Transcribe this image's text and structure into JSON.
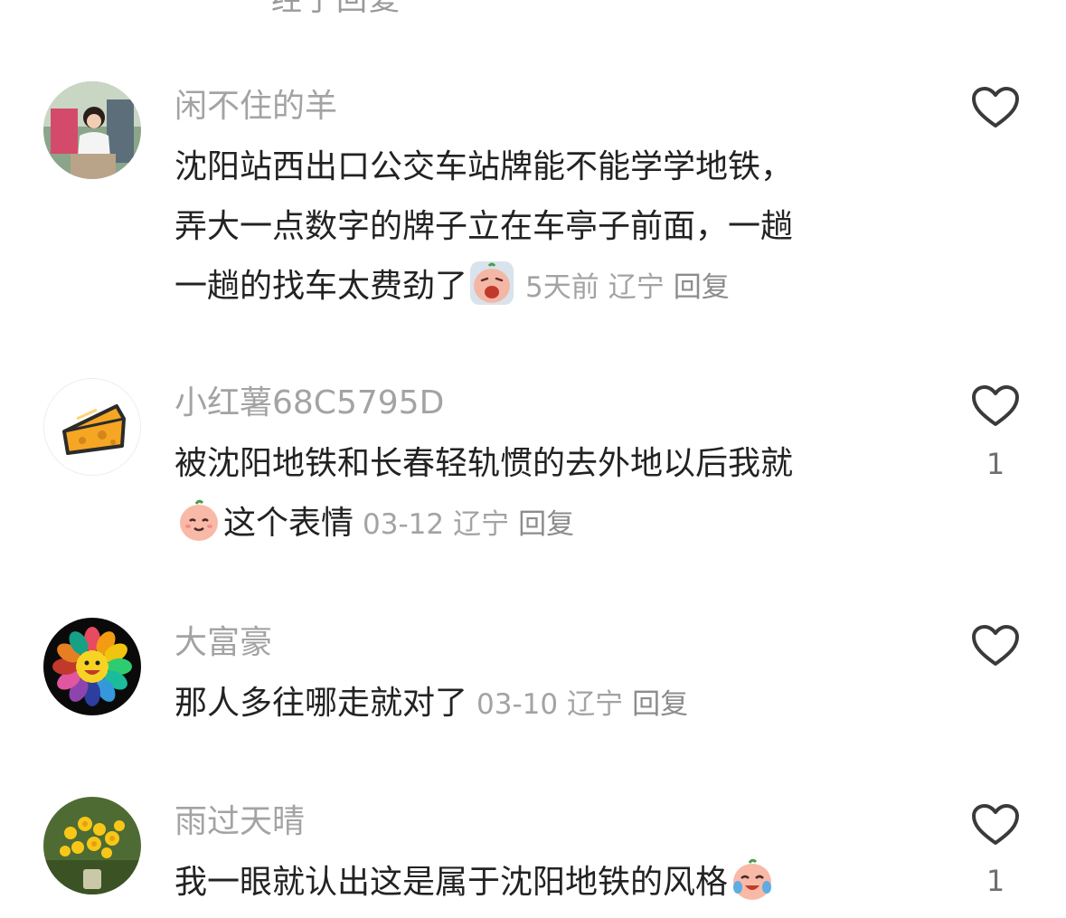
{
  "partial_top_text": "经了回复",
  "comments": [
    {
      "username": "闲不住的羊",
      "lines": [
        "沈阳站西出口公交车站牌能不能学学地铁，",
        "弄大一点数字的牌子立在车亭子前面，一趟",
        "一趟的找车太费劲了"
      ],
      "emoji": "crying-face-emoji",
      "time": "5天前",
      "location": "辽宁",
      "reply": "回复",
      "likes": ""
    },
    {
      "username": "小红薯68C5795D",
      "lines": [
        "被沈阳地铁和长春轻轨惯的去外地以后我就",
        "这个表情"
      ],
      "emoji": "smiling-face-emoji",
      "time": "03-12",
      "location": "辽宁",
      "reply": "回复",
      "likes": "1"
    },
    {
      "username": "大富豪",
      "lines": [
        "那人多往哪走就对了"
      ],
      "time": "03-10",
      "location": "辽宁",
      "reply": "回复",
      "likes": ""
    },
    {
      "username": "雨过天晴",
      "lines": [
        "我一眼就认出这是属于沈阳地铁的风格"
      ],
      "emoji": "laughing-tears-emoji",
      "likes": "1"
    }
  ],
  "colors": {
    "username": "#a3a3a3",
    "text": "#222222",
    "meta": "#a3a3a3",
    "like_outline": "#3a3a3a"
  }
}
